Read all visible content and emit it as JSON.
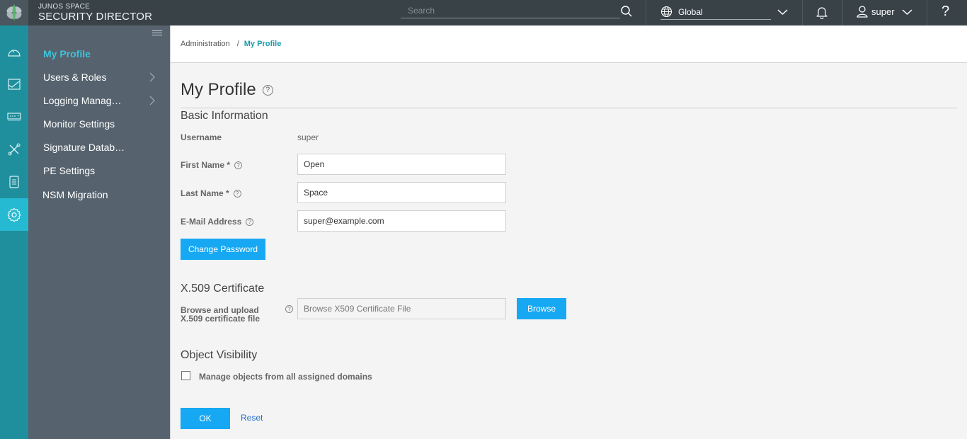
{
  "app": {
    "brand_line1": "JUNOS SPACE",
    "brand_line2": "SECURITY DIRECTOR"
  },
  "topbar": {
    "search_placeholder": "Search",
    "domain_label": "Global",
    "user_label": "super",
    "help_label": "?"
  },
  "rail": {
    "items": [
      {
        "icon": "dashboard-icon"
      },
      {
        "icon": "monitor-icon"
      },
      {
        "icon": "devices-icon"
      },
      {
        "icon": "configure-icon"
      },
      {
        "icon": "reports-icon"
      },
      {
        "icon": "administration-gear-icon",
        "active": true
      }
    ]
  },
  "sidebar": {
    "items": [
      {
        "label": "My Profile",
        "active": true,
        "has_children": false
      },
      {
        "label": "Users & Roles",
        "has_children": true
      },
      {
        "label": "Logging Manag…",
        "has_children": true
      },
      {
        "label": "Monitor Settings",
        "has_children": false
      },
      {
        "label": "Signature Datab…",
        "has_children": false
      },
      {
        "label": "PE Settings",
        "has_children": false
      },
      {
        "label": "NSM Migration",
        "has_children": false
      }
    ]
  },
  "breadcrumb": {
    "parent": "Administration",
    "separator": "/",
    "current": "My Profile"
  },
  "page": {
    "title": "My Profile",
    "help_glyph": "?"
  },
  "basic_info": {
    "heading": "Basic Information",
    "username_label": "Username",
    "username_value": "super",
    "first_name_label": "First Name *",
    "first_name_value": "Open",
    "last_name_label": "Last Name *",
    "last_name_value": "Space",
    "email_label": "E-Mail Address",
    "email_value": "super@example.com",
    "change_password_label": "Change Password"
  },
  "certificate": {
    "heading": "X.509 Certificate",
    "label_line1": "Browse and upload",
    "label_line2": "X.509 certificate file",
    "placeholder": "Browse X509 Certificate File",
    "browse_label": "Browse"
  },
  "visibility": {
    "heading": "Object Visibility",
    "checkbox_label": "Manage objects from all assigned domains",
    "checked": false
  },
  "actions": {
    "ok_label": "OK",
    "reset_label": "Reset"
  },
  "colors": {
    "topbar": "#384247",
    "rail": "#1f8f9d",
    "rail_active": "#26bad2",
    "sidebar": "#56636e",
    "sidebar_active_text": "#3cc3dc",
    "primary_button": "#17a8f3",
    "breadcrumb_current": "#1c9bb0",
    "link": "#2a6fc9"
  }
}
